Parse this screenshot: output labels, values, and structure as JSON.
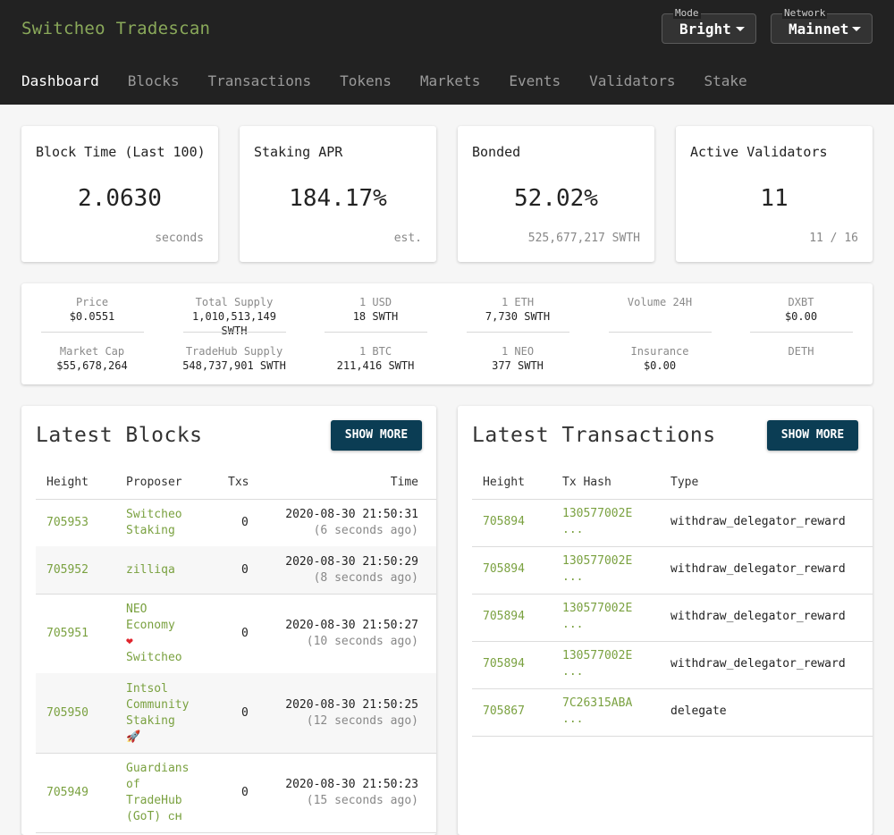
{
  "header": {
    "brand": "Switcheo Tradescan",
    "mode": {
      "caption": "Mode",
      "value": "Bright"
    },
    "network": {
      "caption": "Network",
      "value": "Mainnet"
    },
    "tabs": [
      "Dashboard",
      "Blocks",
      "Transactions",
      "Tokens",
      "Markets",
      "Events",
      "Validators",
      "Stake"
    ],
    "active_tab": "Dashboard"
  },
  "stats": [
    {
      "title": "Block Time (Last 100)",
      "value": "2.0630",
      "sub": "seconds"
    },
    {
      "title": "Staking APR",
      "value": "184.17%",
      "sub": "est."
    },
    {
      "title": "Bonded",
      "value": "52.02%",
      "sub": "525,677,217 SWTH"
    },
    {
      "title": "Active Validators",
      "value": "11",
      "sub": "11 / 16"
    }
  ],
  "prices": [
    {
      "label": "Price",
      "value": "$0.0551"
    },
    {
      "label": "Total Supply",
      "value": "1,010,513,149 SWTH"
    },
    {
      "label": "1 USD",
      "value": "18 SWTH"
    },
    {
      "label": "1 ETH",
      "value": "7,730 SWTH"
    },
    {
      "label": "Volume 24H",
      "value": ""
    },
    {
      "label": "DXBT",
      "value": "$0.00"
    },
    {
      "label": "Market Cap",
      "value": "$55,678,264"
    },
    {
      "label": "TradeHub Supply",
      "value": "548,737,901 SWTH"
    },
    {
      "label": "1 BTC",
      "value": "211,416 SWTH"
    },
    {
      "label": "1 NEO",
      "value": "377 SWTH"
    },
    {
      "label": "Insurance",
      "value": "$0.00"
    },
    {
      "label": "DETH",
      "value": ""
    }
  ],
  "blocks": {
    "title": "Latest Blocks",
    "button": "SHOW MORE",
    "headers": [
      "Height",
      "Proposer",
      "Txs",
      "Time"
    ],
    "rows": [
      {
        "height": "705953",
        "proposer": [
          "Switcheo",
          "Staking"
        ],
        "emoji": "",
        "emoji_name": "",
        "txs": "0",
        "time": "2020-08-30 21:50:31",
        "ago": "(6 seconds ago)"
      },
      {
        "height": "705952",
        "proposer": [
          "zilliqa"
        ],
        "emoji": "",
        "emoji_name": "",
        "txs": "0",
        "time": "2020-08-30 21:50:29",
        "ago": "(8 seconds ago)"
      },
      {
        "height": "705951",
        "proposer": [
          "NEO",
          "Economy",
          "",
          "Switcheo"
        ],
        "emoji": "❤",
        "emoji_name": "heart-icon",
        "txs": "0",
        "time": "2020-08-30 21:50:27",
        "ago": "(10 seconds ago)"
      },
      {
        "height": "705950",
        "proposer": [
          "Intsol",
          "Community",
          "Staking",
          ""
        ],
        "emoji": "🚀",
        "emoji_name": "rocket-icon",
        "txs": "0",
        "time": "2020-08-30 21:50:25",
        "ago": "(12 seconds ago)"
      },
      {
        "height": "705949",
        "proposer": [
          "Guardians",
          "of",
          "TradeHub",
          "(GoT) ᴄʜ"
        ],
        "emoji": "",
        "emoji_name": "",
        "txs": "0",
        "time": "2020-08-30 21:50:23",
        "ago": "(15 seconds ago)"
      }
    ]
  },
  "transactions": {
    "title": "Latest Transactions",
    "button": "SHOW MORE",
    "headers": [
      "Height",
      "Tx Hash",
      "Type"
    ],
    "rows": [
      {
        "height": "705894",
        "hash": "130577002E",
        "hash_more": "...",
        "type": "withdraw_delegator_reward"
      },
      {
        "height": "705894",
        "hash": "130577002E",
        "hash_more": "...",
        "type": "withdraw_delegator_reward"
      },
      {
        "height": "705894",
        "hash": "130577002E",
        "hash_more": "...",
        "type": "withdraw_delegator_reward"
      },
      {
        "height": "705894",
        "hash": "130577002E",
        "hash_more": "...",
        "type": "withdraw_delegator_reward"
      },
      {
        "height": "705867",
        "hash": "7C26315ABA",
        "hash_more": "...",
        "type": "delegate"
      }
    ]
  }
}
